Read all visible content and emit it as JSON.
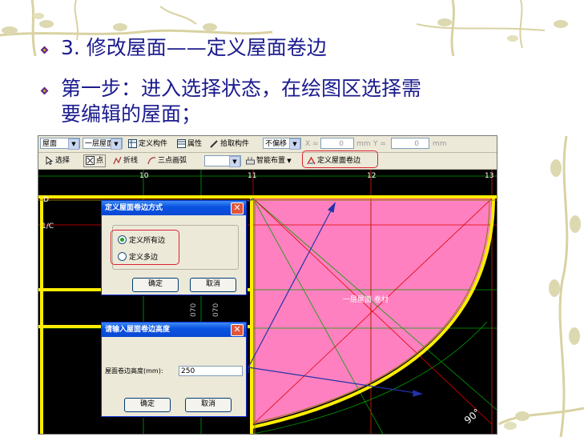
{
  "slide": {
    "bullet1": "3. 修改屋面——定义屋面卷边",
    "bullet2_line1": "第一步：进入选择状态，在绘图区选择需",
    "bullet2_line2": "要编辑的屋面；"
  },
  "toolbar1": {
    "type_select": "屋面",
    "floor_select": "一层屋面",
    "define_member": "定义构件",
    "properties": "属性",
    "pick_member": "拾取构件",
    "offset_select": "不偏移",
    "x_label": "X =",
    "x_value": "0",
    "y_label": "Y =",
    "y_value": "0",
    "unit": "mm"
  },
  "toolbar2": {
    "select": "选择",
    "point": "点",
    "polyline": "折线",
    "three_point_arc": "三点画弧",
    "smart_layout": "智能布置",
    "define_roof_edge": "定义屋面卷边"
  },
  "canvas": {
    "axis_11": "11",
    "axis_12": "12",
    "axis_13": "13",
    "axis_10": "10",
    "axis_d": "D",
    "axis_c": "1/C",
    "dim_label": "070",
    "roof_label": "一层屋面 卷材",
    "angle_label": "90°"
  },
  "dialog_edge_mode": {
    "title": "定义屋面卷边方式",
    "option_all": "定义所有边",
    "option_multi": "定义多边",
    "ok": "确定",
    "cancel": "取消"
  },
  "dialog_height": {
    "title": "请输入屋面卷边高度",
    "label": "屋面卷边高度(mm):",
    "value": "250",
    "ok": "确定",
    "cancel": "取消"
  },
  "colors": {
    "roof_fill": "#ff80c0",
    "beam": "#ffee00",
    "grid_red": "#e00000",
    "grid_green": "#00a000",
    "title_blue": "#1b1b8e"
  }
}
